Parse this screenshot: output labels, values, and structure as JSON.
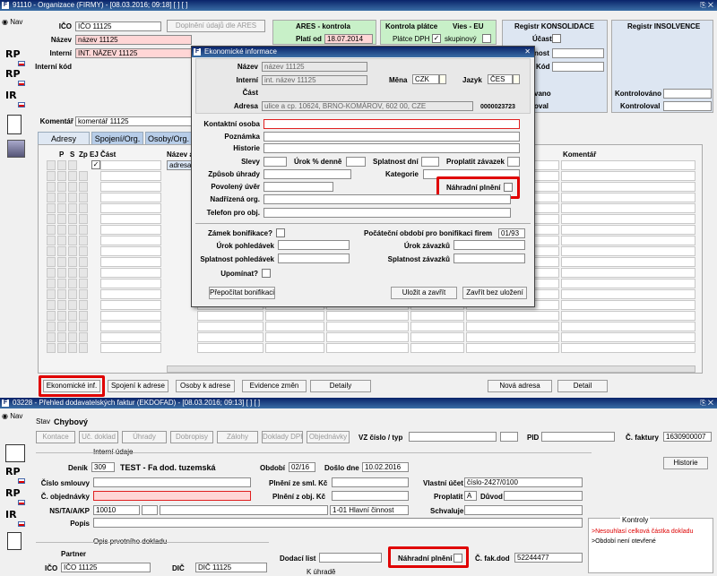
{
  "top_window": {
    "title": "91110 - Organizace (FIRMY) - [08.03.2016; 09:18] [ ] [ ]",
    "nav_label": "Nav",
    "ico_label": "IČO",
    "ico_value": "IČO 11125",
    "ares_btn": "Doplnění údajů dle ARES",
    "nazev_label": "Název",
    "nazev_value": "název 11125",
    "interni_label": "Interní",
    "interni_value": "INT. NÁZEV 11125",
    "interni_kod_label": "Interní kód",
    "ares_kontrola": "ARES - kontrola",
    "plati_od_label": "Platí od",
    "plati_od_value": "18.07.2014",
    "kontrola_platce": "Kontrola plátce",
    "platce_dph": "Plátce DPH",
    "vies": "Vies - EU",
    "skupinovy": "skupinový",
    "registr_konsolidace": "Registr KONSOLIDACE",
    "ucast": "Účast",
    "registr_insolvence": "Registr INSOLVENCE",
    "nost": "nost",
    "kod": "Kód",
    "vano": "vano",
    "oval": "oval",
    "kontrolovano": "Kontrolováno",
    "kontroloval": "Kontroloval",
    "komentar_label": "Komentář",
    "komentar_value": "komentář 11125",
    "tabs": [
      "Adresy",
      "Spojení/Org.",
      "Osoby/Org."
    ],
    "grid_headers": [
      "P",
      "S",
      "Zp",
      "EJ",
      "Část",
      "Název a"
    ],
    "grid_row_value": "adresa",
    "komentar_col": "Komentář",
    "buttons": [
      "Ekonomické inf.",
      "Spojení k adrese",
      "Osoby k adrese",
      "Evidence změn",
      "Detaily",
      "Nová adresa",
      "Detail"
    ]
  },
  "dialog": {
    "title": "Ekonomické informace",
    "nazev_label": "Název",
    "nazev_value": "název 11125",
    "interni_label": "Interní",
    "interni_value": "int. název 11125",
    "mena_label": "Měna",
    "mena_value": "CZK",
    "jazyk_label": "Jazyk",
    "jazyk_value": "ČES",
    "cast_label": "Část",
    "adresa_label": "Adresa",
    "adresa_value": "ulice a cp. 10624, BRNO-KOMÁROV, 602 00, CZE",
    "adresa_num": "0000023723",
    "kontaktni_osoba": "Kontaktní osoba",
    "poznamka": "Poznámka",
    "historie": "Historie",
    "slevy": "Slevy",
    "urok_denne": "Úrok % denně",
    "splatnost_dni": "Splatnost dní",
    "proplatit_zavazek": "Proplatit závazek",
    "zpusob_uhrady": "Způsob úhrady",
    "kategorie": "Kategorie",
    "povoleny_uver": "Povolený úvěr",
    "nahradni_plneni": "Náhradní plnění",
    "nadrizena_org": "Nadřízená org.",
    "telefon": "Telefon pro obj.",
    "zamek_bonifikace": "Zámek bonifikace?",
    "pocatecni_obdobi": "Počáteční období pro bonifikaci firem",
    "pocatecni_value": "01/93",
    "urok_pohledavek": "Úrok pohledávek",
    "urok_zavazku": "Úrok závazků",
    "splatnost_pohledavek": "Splatnost pohledávek",
    "splatnost_zavazku": "Splatnost závazků",
    "upominat": "Upomínat?",
    "prepocitat": "Přepočítat bonifikaci",
    "ulozit": "Uložit a zavřít",
    "zavrit": "Zavřít bez uložení"
  },
  "bottom_window": {
    "title": "03228 - Přehled dodavatelských faktur (EKDOFAD) - [08.03.2016; 09:13] [ ] [ ]",
    "nav_label": "Nav",
    "stav_label": "Stav",
    "stav_value": "Chybový",
    "toolbar": [
      "Kontace",
      "Uč. doklad",
      "Úhrady",
      "Dobropisy",
      "Zálohy",
      "Doklady DPH",
      "Objednávky"
    ],
    "vz_label": "VZ číslo / typ",
    "pid_label": "PID",
    "c_faktury_label": "Č. faktury",
    "c_faktury_value": "1630900007",
    "interni_udaje": "Interní údaje",
    "denik_label": "Deník",
    "denik_value": "309",
    "denik_desc": "TEST - Fa dod. tuzemská",
    "obdobi_label": "Období",
    "obdobi_value": "02/16",
    "doslo_label": "Došlo dne",
    "doslo_value": "10.02.2016",
    "historie_btn": "Historie",
    "cislo_smlouvy": "Číslo smlouvy",
    "plneni_smlouvy": "Plnění ze sml. Kč",
    "vlastni_ucet": "Vlastní účet",
    "vlastni_ucet_value": "číslo-2427/0100",
    "c_objednavky": "Č. objednávky",
    "plneni_obj": "Plnění z obj. Kč",
    "proplatit": "Proplatit",
    "proplatit_value": "A",
    "duvod": "Důvod",
    "ns_label": "NS/TA/A/KP",
    "ns_value": "10010",
    "hlavni_cinnost": "1-01 Hlavní činnost",
    "schvaluje": "Schvaluje",
    "popis": "Popis",
    "kontroly": "Kontroly",
    "kontroly_items": [
      ">Nesouhlasí celková částka dokladu",
      ">Období není otevřené"
    ],
    "opis": "Opis prvotního dokladu",
    "partner": "Partner",
    "ico_label": "IČO",
    "ico_value": "IČO 11125",
    "dic_label": "DIČ",
    "dic_value": "DIČ 11125",
    "dodaci_list": "Dodací list",
    "nahradni_plneni": "Náhradní plnění",
    "c_fak_dod": "Č. fak.dod",
    "c_fak_dod_value": "52244477",
    "k_uhrade": "K úhradě"
  },
  "colors": {
    "title_bar": "#0a246a",
    "highlight_red": "#e00000",
    "pink_field": "#ffd6d6",
    "tab_blue": "#b7cde8"
  },
  "sidebar_icons": [
    "RP",
    "RP",
    "IR"
  ]
}
